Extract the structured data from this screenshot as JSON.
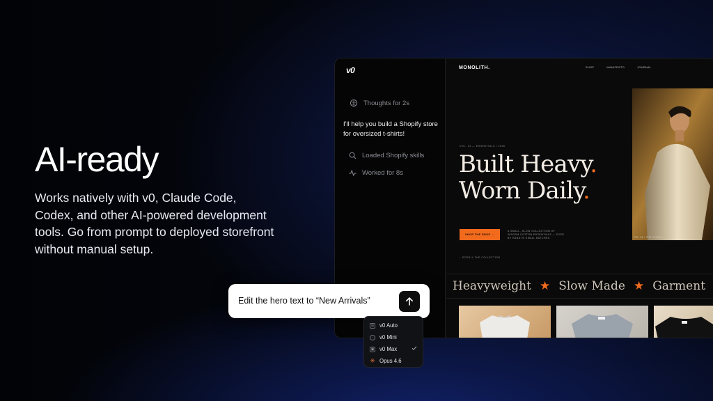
{
  "hero": {
    "title": "AI-ready",
    "body": "Works natively with v0, Claude Code, Codex, and other AI-powered development tools. Go from prompt to deployed storefront without manual setup."
  },
  "chat": {
    "logo": "v0",
    "thought": "Thoughts for 2s",
    "message": "I'll help you build a Shopify store for oversized t-shirts!",
    "steps": [
      {
        "icon": "search-icon",
        "label": "Loaded Shopify skills"
      },
      {
        "icon": "activity-icon",
        "label": "Worked for 8s"
      }
    ]
  },
  "site": {
    "brand": "MONOLITH.",
    "nav": [
      "SHOP",
      "MANIFESTO",
      "JOURNAL"
    ],
    "eyebrow": "VOL. 01 — ESSENTIALS / 2026",
    "headline_1": "Built Heavy",
    "headline_2": "Worn Daily",
    "dot": ".",
    "cta": "SHOP THE DROP →",
    "cta_desc": "A SMALL, SLOW COLLECTION OF 300GSM COTTON ESSENTIALS — DYED BY HAND IN SMALL BATCHES.",
    "scroll": "↓ SCROLL THE COLLECTION",
    "photo_caption": "FIG. 01 / THE CREAM",
    "marquee": [
      "Heavyweight",
      "Slow Made",
      "Garment"
    ],
    "accent": "#f26b1d"
  },
  "prompt": {
    "text": "Edit the hero text to “New Arrivals”"
  },
  "models": {
    "items": [
      {
        "icon": "auto-icon",
        "label": "v0 Auto",
        "selected": false
      },
      {
        "icon": "mini-icon",
        "label": "v0 Mini",
        "selected": false
      },
      {
        "icon": "max-icon",
        "label": "v0 Max",
        "selected": true
      },
      {
        "icon": "claude-burst-icon",
        "label": "Opus 4.6",
        "selected": false
      }
    ]
  }
}
